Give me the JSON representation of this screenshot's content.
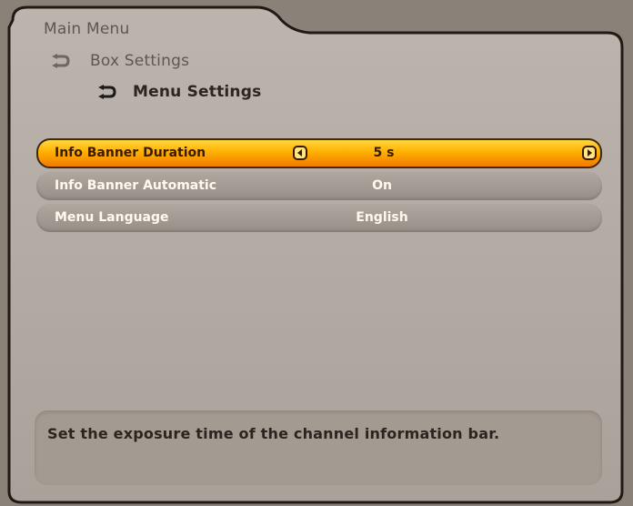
{
  "breadcrumbs": [
    {
      "label": "Main Menu"
    },
    {
      "label": "Box Settings",
      "icon": "back-arrow-icon"
    },
    {
      "label": "Menu Settings",
      "icon": "back-arrow-icon"
    }
  ],
  "menu_items": [
    {
      "label": "Info Banner Duration",
      "value": "5 s",
      "selected": true
    },
    {
      "label": "Info Banner Automatic",
      "value": "On",
      "selected": false
    },
    {
      "label": "Menu Language",
      "value": "English",
      "selected": false
    }
  ],
  "help_text": "Set the exposure time of the channel information bar.",
  "colors": {
    "selected_highlight": "#ffb000",
    "row_background": "#a49c94",
    "panel_background": "#b5ada5"
  }
}
